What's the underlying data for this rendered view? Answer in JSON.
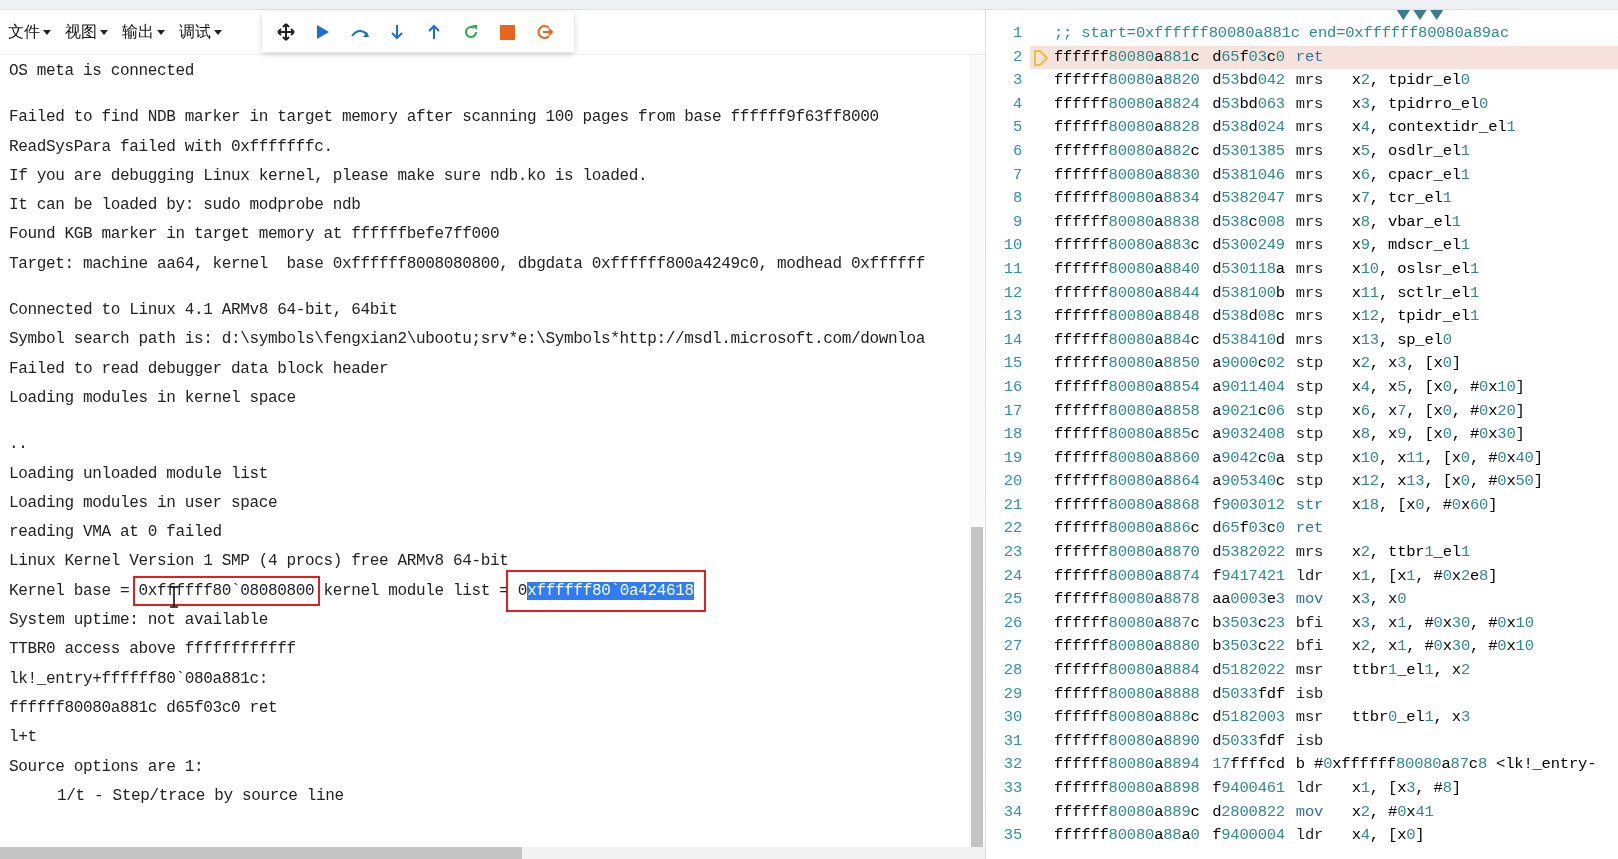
{
  "menu": [
    {
      "label": "文件"
    },
    {
      "label": "视图"
    },
    {
      "label": "输出"
    },
    {
      "label": "调试"
    }
  ],
  "debug_toolbar": [
    {
      "kind": "move"
    },
    {
      "kind": "run"
    },
    {
      "kind": "step_over"
    },
    {
      "kind": "step_into"
    },
    {
      "kind": "step_out"
    },
    {
      "kind": "restart"
    },
    {
      "kind": "stop"
    },
    {
      "kind": "detach"
    }
  ],
  "output": [
    {
      "kind": "text",
      "segments": [
        {
          "text": "OS meta is connected"
        }
      ]
    },
    {
      "kind": "blank"
    },
    {
      "kind": "text",
      "segments": [
        {
          "text": "Failed to find NDB marker in target memory after scanning 100 pages from base ffffff9f63ff8000"
        }
      ]
    },
    {
      "kind": "text",
      "segments": [
        {
          "text": "ReadSysPara failed with 0xfffffffc."
        }
      ]
    },
    {
      "kind": "text",
      "segments": [
        {
          "text": "If you are debugging Linux kernel, please make sure ndb.ko is loaded."
        }
      ]
    },
    {
      "kind": "text",
      "segments": [
        {
          "text": "It can be loaded by: sudo modprobe ndb"
        }
      ]
    },
    {
      "kind": "text",
      "segments": [
        {
          "text": "Found KGB marker in target memory at ffffffbefe7ff000"
        }
      ]
    },
    {
      "kind": "text",
      "segments": [
        {
          "text": "Target: machine aa64, kernel  base 0xffffff8008080800, dbgdata 0xffffff800a4249c0, modhead 0xffffff"
        }
      ]
    },
    {
      "kind": "blank"
    },
    {
      "kind": "text",
      "segments": [
        {
          "text": "Connected to Linux 4.1 ARMv8 64-bit, 64bit"
        }
      ]
    },
    {
      "kind": "text",
      "segments": [
        {
          "text": "Symbol search path is: d:\\symbols\\fengxian2\\ubootu;srv*e:\\Symbols*http://msdl.microsoft.com/downloa"
        }
      ]
    },
    {
      "kind": "text",
      "segments": [
        {
          "text": "Failed to read debugger data block header"
        }
      ]
    },
    {
      "kind": "text",
      "segments": [
        {
          "text": "Loading modules in kernel space"
        }
      ]
    },
    {
      "kind": "blank"
    },
    {
      "kind": "text",
      "segments": [
        {
          "text": ".."
        }
      ]
    },
    {
      "kind": "text",
      "segments": [
        {
          "text": "Loading unloaded module list"
        }
      ]
    },
    {
      "kind": "text",
      "segments": [
        {
          "text": "Loading modules in user space"
        }
      ]
    },
    {
      "kind": "text",
      "segments": [
        {
          "text": "reading VMA at 0 failed"
        }
      ]
    },
    {
      "kind": "text",
      "segments": [
        {
          "text": "Linux Kernel Version 1 SMP (4 procs) free ARMv8 64-bit"
        }
      ]
    },
    {
      "kind": "text",
      "segments": [
        {
          "text": "Kernel base = "
        },
        {
          "boxed": true,
          "cursor": true,
          "parts": [
            {
              "text": "0xffffff80`08080800",
              "selected": false
            }
          ]
        },
        {
          "text": " kernel module list = "
        },
        {
          "boxed": true,
          "cursor": false,
          "parts": [
            {
              "text": "0",
              "selected": false
            },
            {
              "text": "xffffff80`0a424618",
              "selected": true
            }
          ]
        }
      ]
    },
    {
      "kind": "text",
      "segments": [
        {
          "text": "System uptime: not available"
        }
      ]
    },
    {
      "kind": "text",
      "segments": [
        {
          "text": "TTBR0 access above ffffffffffff"
        }
      ]
    },
    {
      "kind": "text",
      "segments": [
        {
          "text": "lk!_entry+ffffff80`080a881c:"
        }
      ]
    },
    {
      "kind": "text",
      "segments": [
        {
          "text": "ffffff80080a881c d65f03c0 ret"
        }
      ]
    },
    {
      "kind": "text",
      "segments": [
        {
          "text": "l+t"
        }
      ]
    },
    {
      "kind": "text",
      "segments": [
        {
          "text": "Source options are 1:"
        }
      ]
    },
    {
      "kind": "text",
      "indent": true,
      "segments": [
        {
          "text": "1/t - Step/trace by source line"
        }
      ]
    }
  ],
  "disassembly": [
    {
      "num": "1",
      "kind": "comment",
      "text": ";; start=0xffffff80080a881c end=0xffffff80080a89ac",
      "current": false
    },
    {
      "num": "2",
      "kind": "instr",
      "addr": "ffffff80080a881c",
      "code": "d65f03c0",
      "op": "ret",
      "keyword": true,
      "current": true
    },
    {
      "num": "3",
      "kind": "instr",
      "addr": "ffffff80080a8820",
      "code": "d53bd042",
      "op": "mrs",
      "keyword": false,
      "args": "x2, tpidr_el0",
      "current": false
    },
    {
      "num": "4",
      "kind": "instr",
      "addr": "ffffff80080a8824",
      "code": "d53bd063",
      "op": "mrs",
      "keyword": false,
      "args": "x3, tpidrro_el0",
      "current": false
    },
    {
      "num": "5",
      "kind": "instr",
      "addr": "ffffff80080a8828",
      "code": "d538d024",
      "op": "mrs",
      "keyword": false,
      "args": "x4, contextidr_el1",
      "current": false
    },
    {
      "num": "6",
      "kind": "instr",
      "addr": "ffffff80080a882c",
      "code": "d5301385",
      "op": "mrs",
      "keyword": false,
      "args": "x5, osdlr_el1",
      "current": false
    },
    {
      "num": "7",
      "kind": "instr",
      "addr": "ffffff80080a8830",
      "code": "d5381046",
      "op": "mrs",
      "keyword": false,
      "args": "x6, cpacr_el1",
      "current": false
    },
    {
      "num": "8",
      "kind": "instr",
      "addr": "ffffff80080a8834",
      "code": "d5382047",
      "op": "mrs",
      "keyword": false,
      "args": "x7, tcr_el1",
      "current": false
    },
    {
      "num": "9",
      "kind": "instr",
      "addr": "ffffff80080a8838",
      "code": "d538c008",
      "op": "mrs",
      "keyword": false,
      "args": "x8, vbar_el1",
      "current": false
    },
    {
      "num": "10",
      "kind": "instr",
      "addr": "ffffff80080a883c",
      "code": "d5300249",
      "op": "mrs",
      "keyword": false,
      "args": "x9, mdscr_el1",
      "current": false
    },
    {
      "num": "11",
      "kind": "instr",
      "addr": "ffffff80080a8840",
      "code": "d530118a",
      "op": "mrs",
      "keyword": false,
      "args": "x10, oslsr_el1",
      "current": false
    },
    {
      "num": "12",
      "kind": "instr",
      "addr": "ffffff80080a8844",
      "code": "d538100b",
      "op": "mrs",
      "keyword": false,
      "args": "x11, sctlr_el1",
      "current": false
    },
    {
      "num": "13",
      "kind": "instr",
      "addr": "ffffff80080a8848",
      "code": "d538d08c",
      "op": "mrs",
      "keyword": false,
      "args": "x12, tpidr_el1",
      "current": false
    },
    {
      "num": "14",
      "kind": "instr",
      "addr": "ffffff80080a884c",
      "code": "d538410d",
      "op": "mrs",
      "keyword": false,
      "args": "x13, sp_el0",
      "current": false
    },
    {
      "num": "15",
      "kind": "instr",
      "addr": "ffffff80080a8850",
      "code": "a9000c02",
      "op": "stp",
      "keyword": false,
      "args": "x2, x3, [x0]",
      "current": false
    },
    {
      "num": "16",
      "kind": "instr",
      "addr": "ffffff80080a8854",
      "code": "a9011404",
      "op": "stp",
      "keyword": false,
      "args": "x4, x5, [x0, #0x10]",
      "current": false
    },
    {
      "num": "17",
      "kind": "instr",
      "addr": "ffffff80080a8858",
      "code": "a9021c06",
      "op": "stp",
      "keyword": false,
      "args": "x6, x7, [x0, #0x20]",
      "current": false
    },
    {
      "num": "18",
      "kind": "instr",
      "addr": "ffffff80080a885c",
      "code": "a9032408",
      "op": "stp",
      "keyword": false,
      "args": "x8, x9, [x0, #0x30]",
      "current": false
    },
    {
      "num": "19",
      "kind": "instr",
      "addr": "ffffff80080a8860",
      "code": "a9042c0a",
      "op": "stp",
      "keyword": false,
      "args": "x10, x11, [x0, #0x40]",
      "current": false
    },
    {
      "num": "20",
      "kind": "instr",
      "addr": "ffffff80080a8864",
      "code": "a905340c",
      "op": "stp",
      "keyword": false,
      "args": "x12, x13, [x0, #0x50]",
      "current": false
    },
    {
      "num": "21",
      "kind": "instr",
      "addr": "ffffff80080a8868",
      "code": "f9003012",
      "op": "str",
      "keyword": true,
      "args": "x18, [x0, #0x60]",
      "current": false
    },
    {
      "num": "22",
      "kind": "instr",
      "addr": "ffffff80080a886c",
      "code": "d65f03c0",
      "op": "ret",
      "keyword": true,
      "current": false
    },
    {
      "num": "23",
      "kind": "instr",
      "addr": "ffffff80080a8870",
      "code": "d5382022",
      "op": "mrs",
      "keyword": false,
      "args": "x2, ttbr1_el1",
      "current": false
    },
    {
      "num": "24",
      "kind": "instr",
      "addr": "ffffff80080a8874",
      "code": "f9417421",
      "op": "ldr",
      "keyword": false,
      "args": "x1, [x1, #0x2e8]",
      "current": false
    },
    {
      "num": "25",
      "kind": "instr",
      "addr": "ffffff80080a8878",
      "code": "aa0003e3",
      "op": "mov",
      "keyword": true,
      "args": "x3, x0",
      "current": false
    },
    {
      "num": "26",
      "kind": "instr",
      "addr": "ffffff80080a887c",
      "code": "b3503c23",
      "op": "bfi",
      "keyword": false,
      "args": "x3, x1, #0x30, #0x10",
      "current": false
    },
    {
      "num": "27",
      "kind": "instr",
      "addr": "ffffff80080a8880",
      "code": "b3503c22",
      "op": "bfi",
      "keyword": false,
      "args": "x2, x1, #0x30, #0x10",
      "current": false
    },
    {
      "num": "28",
      "kind": "instr",
      "addr": "ffffff80080a8884",
      "code": "d5182022",
      "op": "msr",
      "keyword": false,
      "args": "ttbr1_el1, x2",
      "current": false
    },
    {
      "num": "29",
      "kind": "instr",
      "addr": "ffffff80080a8888",
      "code": "d5033fdf",
      "op": "isb",
      "keyword": false,
      "current": false
    },
    {
      "num": "30",
      "kind": "instr",
      "addr": "ffffff80080a888c",
      "code": "d5182003",
      "op": "msr",
      "keyword": false,
      "args": "ttbr0_el1, x3",
      "current": false
    },
    {
      "num": "31",
      "kind": "instr",
      "addr": "ffffff80080a8890",
      "code": "d5033fdf",
      "op": "isb",
      "keyword": false,
      "current": false
    },
    {
      "num": "32",
      "kind": "branch",
      "addr": "ffffff80080a8894",
      "code": "17ffffcd",
      "text": "b #0xffffff80080a87c8 <lk!_entry-",
      "current": false
    },
    {
      "num": "33",
      "kind": "instr",
      "addr": "ffffff80080a8898",
      "code": "f9400461",
      "op": "ldr",
      "keyword": false,
      "args": "x1, [x3, #8]",
      "current": false
    },
    {
      "num": "34",
      "kind": "instr",
      "addr": "ffffff80080a889c",
      "code": "d2800822",
      "op": "mov",
      "keyword": true,
      "args": "x2, #0x41",
      "current": false
    },
    {
      "num": "35",
      "kind": "instr",
      "addr": "ffffff80080a88a0",
      "code": "f9400004",
      "op": "ldr",
      "keyword": false,
      "args": "x4, [x0]",
      "current": false
    }
  ]
}
